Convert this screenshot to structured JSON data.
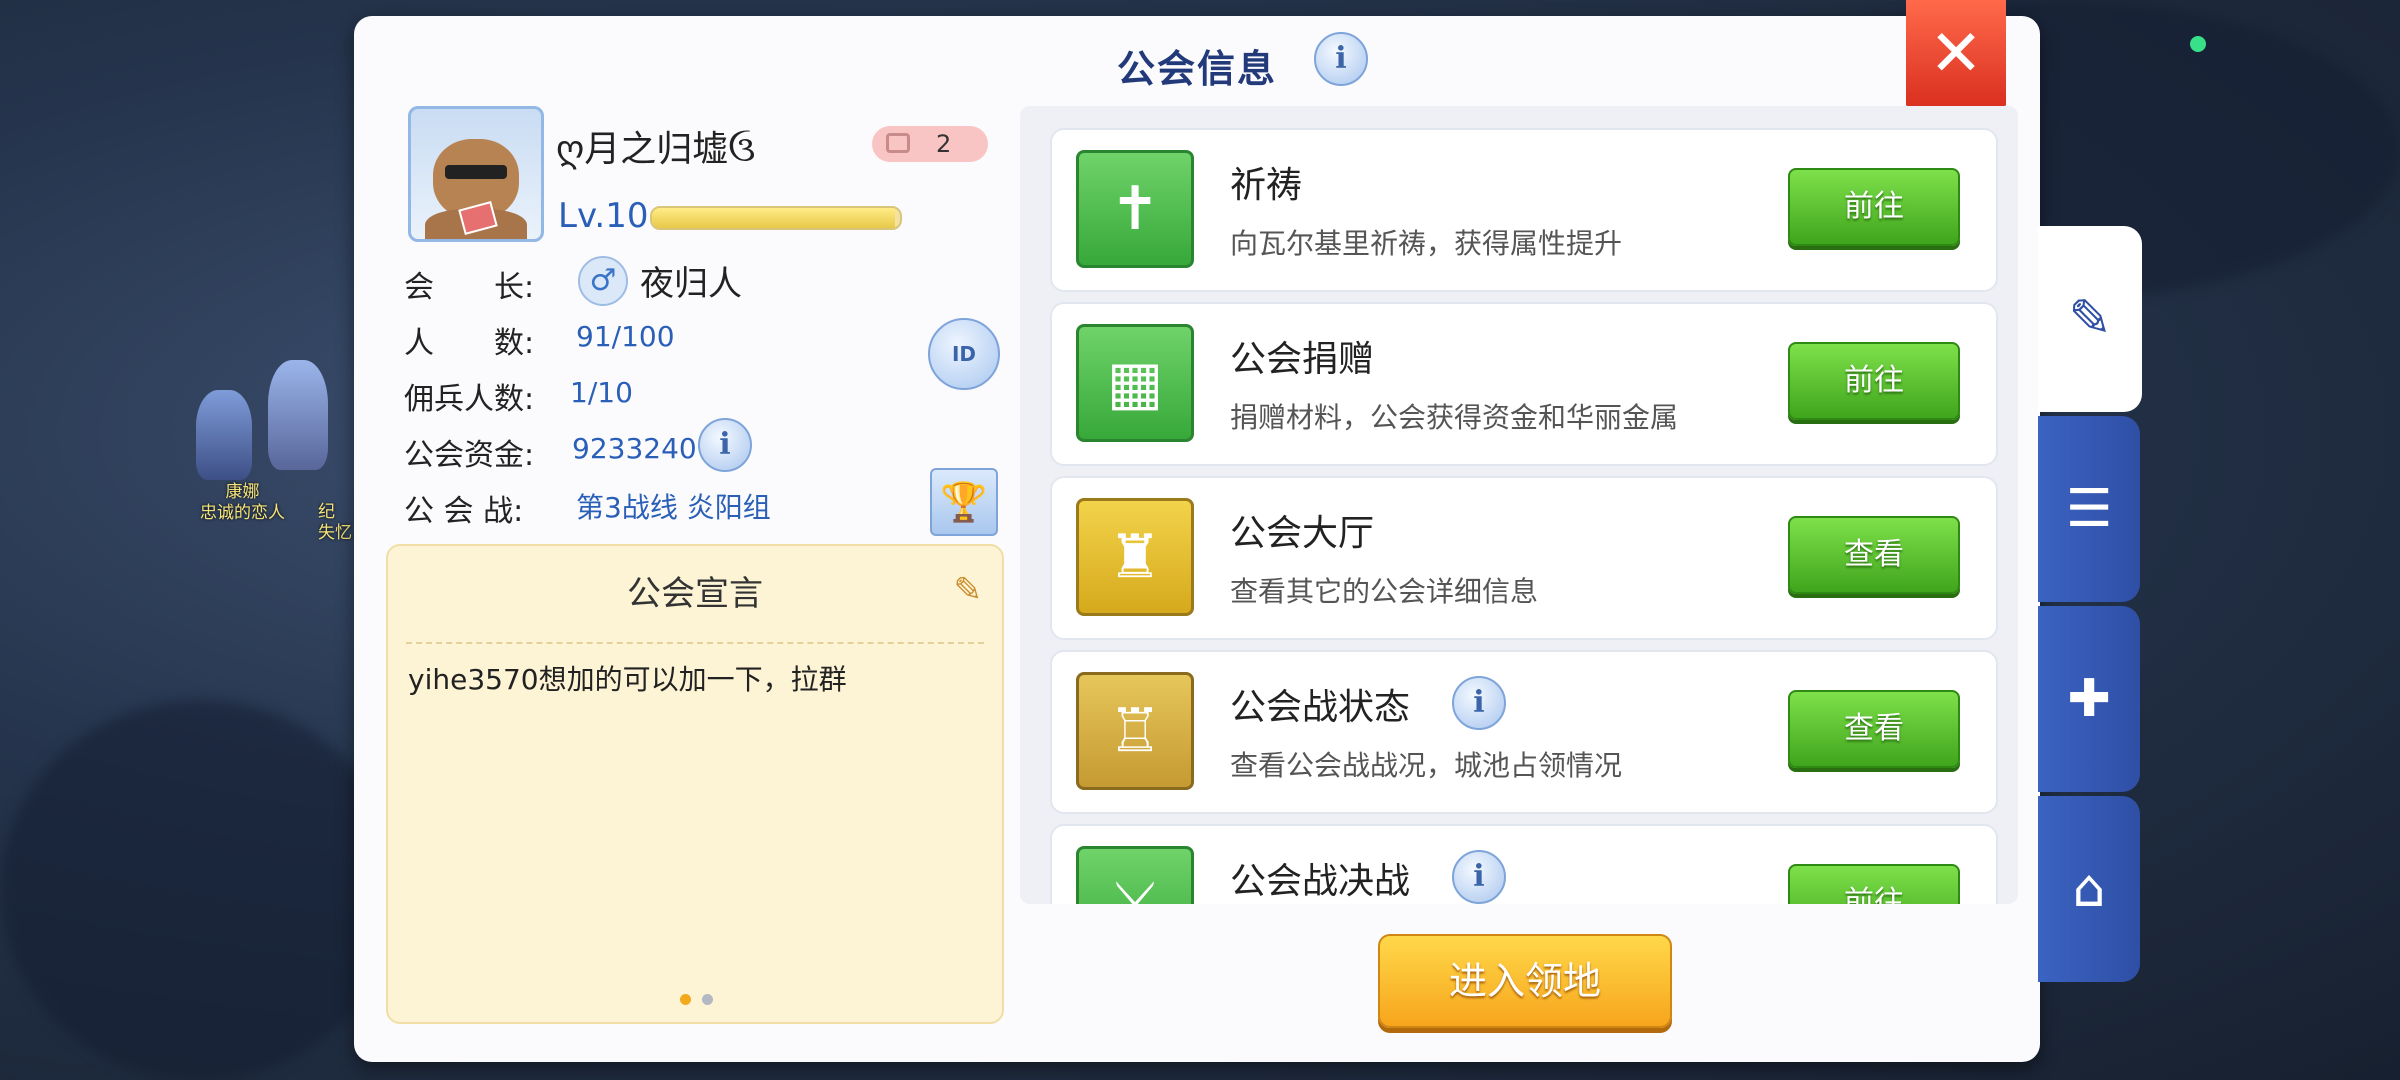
{
  "window": {
    "title": "公会信息"
  },
  "colors": {
    "accent": "#233a7a",
    "go_button": "#4fb52a",
    "enter_button": "#f7b21c",
    "close_button": "#e0381f",
    "tab_blue": "#3457b3"
  },
  "npcs": [
    {
      "name": "康娜",
      "subtitle": "忠诚的恋人"
    },
    {
      "name": "纪",
      "subtitle": "失忆"
    }
  ],
  "profile": {
    "guild_name": "ღ月之归墟ઉ",
    "server_badge": "2",
    "level": "Lv.10",
    "exp_fraction": 0.98,
    "leader_label": "会　　长:",
    "leader_name": "夜归人",
    "members_label": "人　　数:",
    "members": "91/100",
    "mercenary_label": "佣兵人数:",
    "mercenary": "1/10",
    "funds_label": "公会资金:",
    "funds": "9233240",
    "war_label": "公 会 战:",
    "war": "第3战线  炎阳组",
    "id_icon_text": "ID"
  },
  "declaration": {
    "title": "公会宣言",
    "text": "yihe3570想加的可以加一下，拉群"
  },
  "activities": [
    {
      "title": "祈祷",
      "desc": "向瓦尔基里祈祷，获得属性提升",
      "button": "前往",
      "icon": "prayer-icon"
    },
    {
      "title": "公会捐赠",
      "desc": "捐赠材料，公会获得资金和华丽金属",
      "button": "前往",
      "icon": "donation-icon"
    },
    {
      "title": "公会大厅",
      "desc": "查看其它的公会详细信息",
      "button": "查看",
      "icon": "castle-icon"
    },
    {
      "title": "公会战状态",
      "desc": "查看公会战战况，城池占领情况",
      "button": "查看",
      "icon": "fortress-icon"
    },
    {
      "title": "公会战决战",
      "desc": "",
      "button": "前往",
      "icon": "crossed-swords-icon"
    }
  ],
  "enter_button": "进入领地"
}
